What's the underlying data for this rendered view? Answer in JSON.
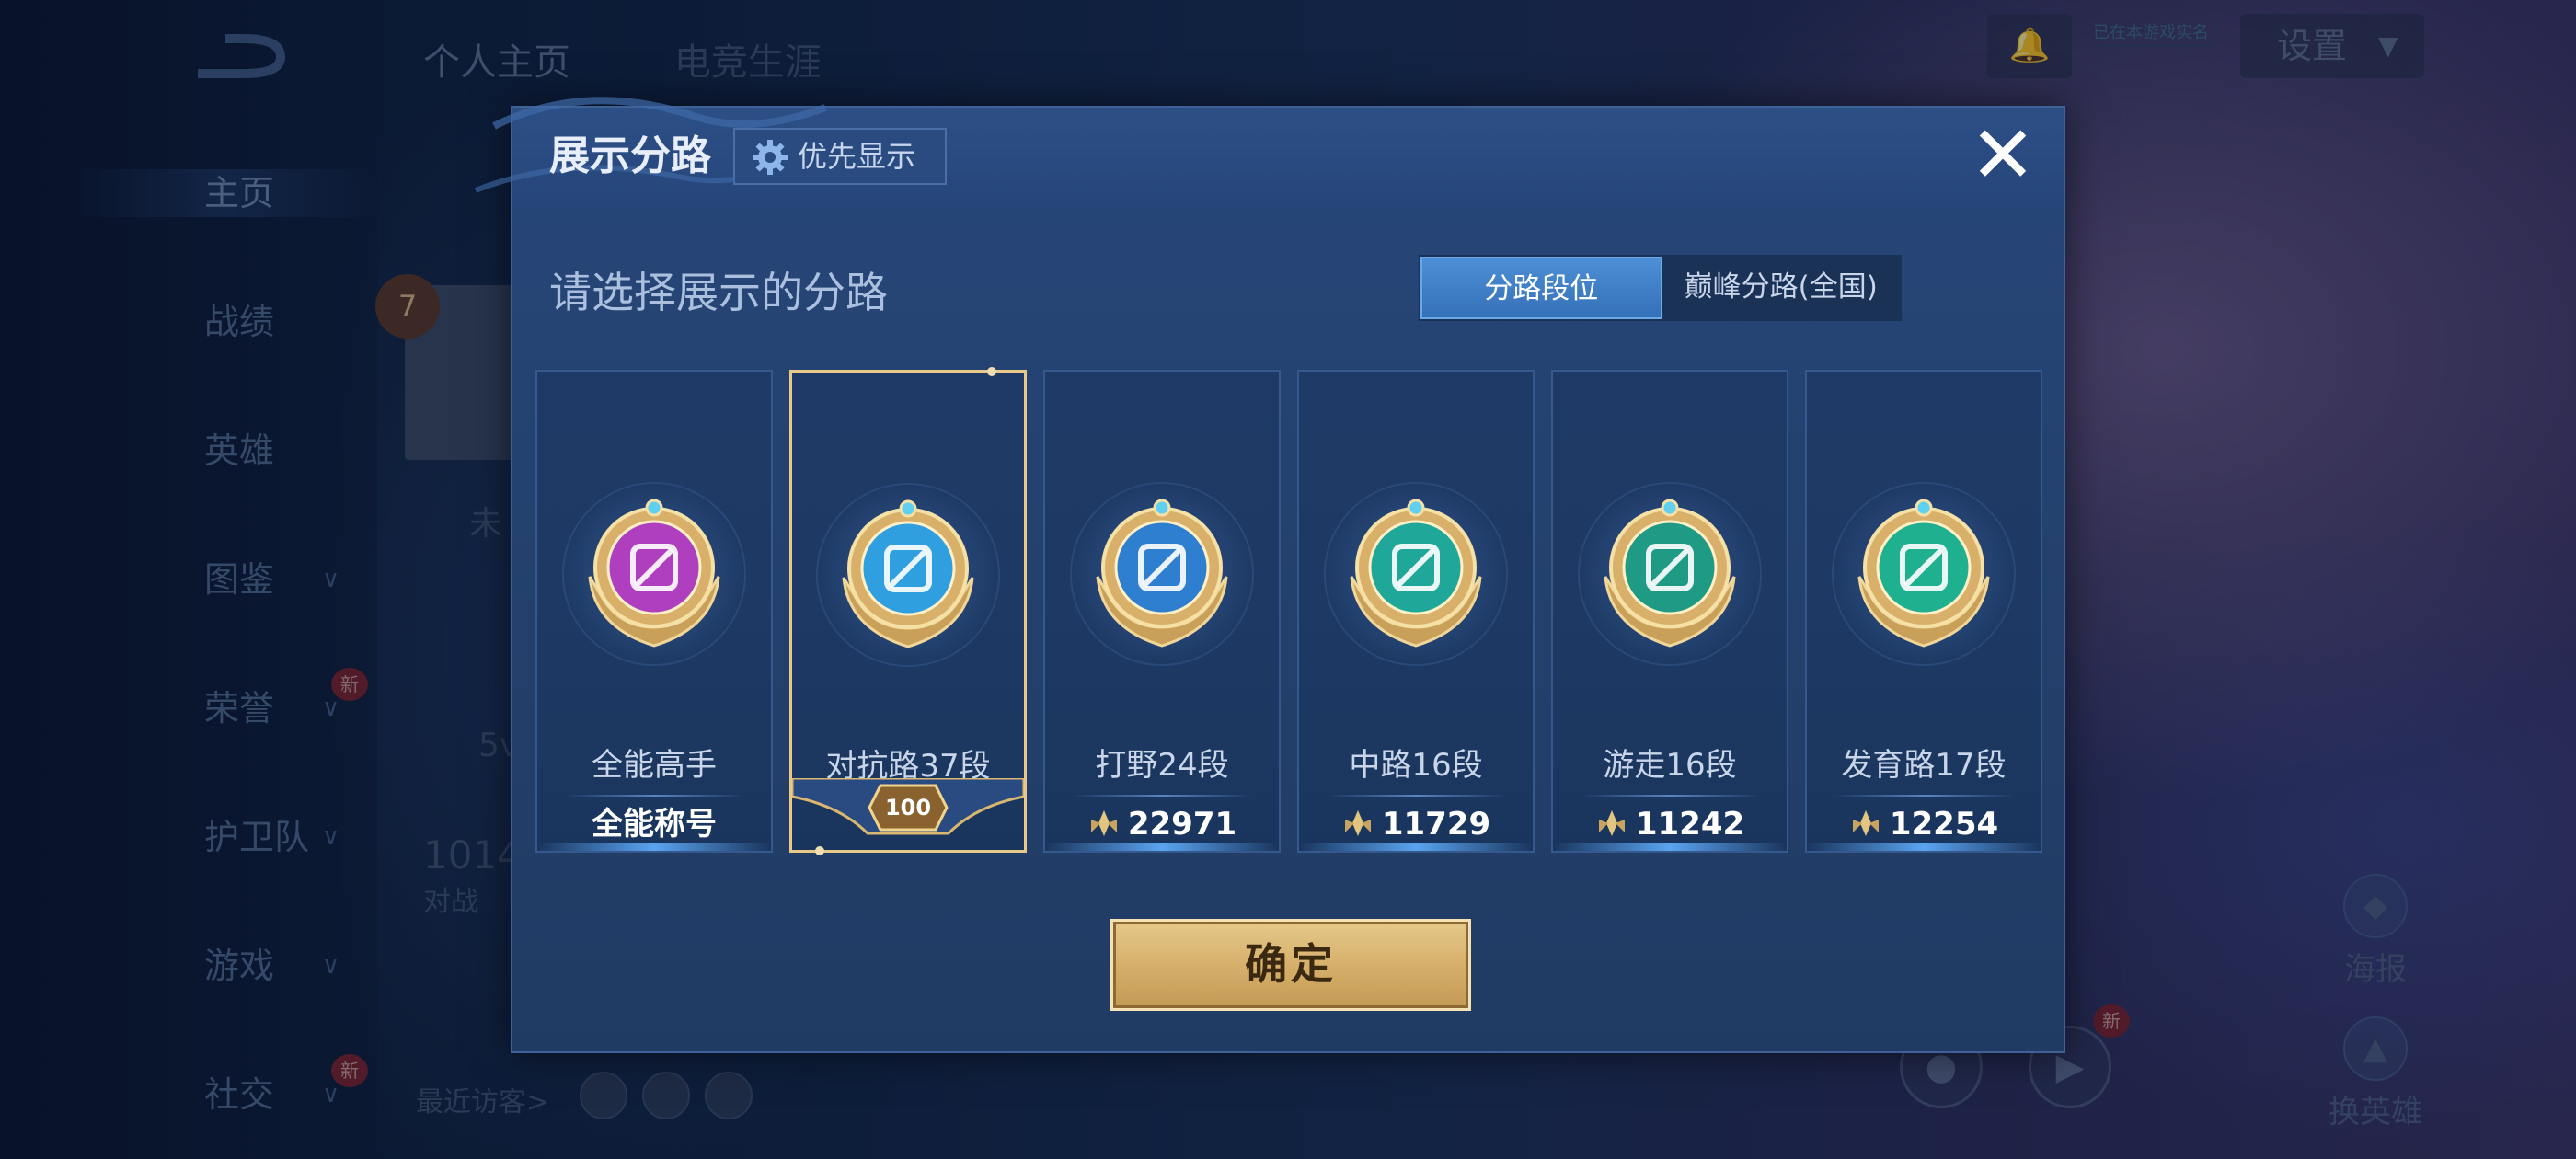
{
  "background": {
    "back_icon": "back-arrow-icon",
    "top_tabs": [
      "个人主页",
      "电竞生涯"
    ],
    "nav": [
      {
        "label": "主页",
        "chevron": false,
        "new": false
      },
      {
        "label": "战绩",
        "chevron": false,
        "new": false
      },
      {
        "label": "英雄",
        "chevron": false,
        "new": false
      },
      {
        "label": "图鉴",
        "chevron": true,
        "new": false
      },
      {
        "label": "荣誉",
        "chevron": true,
        "new": true
      },
      {
        "label": "护卫队",
        "chevron": true,
        "new": false
      },
      {
        "label": "游戏",
        "chevron": true,
        "new": false
      },
      {
        "label": "社交",
        "chevron": true,
        "new": true
      }
    ],
    "new_badge": "新",
    "profile_level": "7",
    "partial_texts": [
      "未",
      "5v",
      "1014",
      "对战"
    ],
    "recent_visitors_label": "最近访客>",
    "settings_label": "设置",
    "tiny_tag": "已在本游戏实名",
    "right_actions": [
      {
        "label": "海报",
        "icon": "poster-icon"
      },
      {
        "label": "换英雄",
        "icon": "swap-hero-icon"
      }
    ],
    "right_new_badge": "新"
  },
  "modal": {
    "title": "展示分路",
    "priority_button": "优先显示",
    "close_icon": "close-icon",
    "section_title": "请选择展示的分路",
    "segments": [
      {
        "label": "分路段位",
        "active": true
      },
      {
        "label": "巅峰分路(全国)",
        "active": false
      }
    ],
    "cards": [
      {
        "name": "全能高手",
        "value": "全能称号",
        "badge": "all-round-emblem-icon",
        "badge_color": "#b03fc0",
        "show_points_icon": false,
        "selected": false
      },
      {
        "name": "对抗路37段",
        "value": "100",
        "badge": "clash-lane-emblem-icon",
        "badge_color": "#2f9fe0",
        "show_points_icon": false,
        "selected": true
      },
      {
        "name": "打野24段",
        "value": "22971",
        "badge": "jungle-emblem-icon",
        "badge_color": "#2f7fd0",
        "show_points_icon": true,
        "selected": false
      },
      {
        "name": "中路16段",
        "value": "11729",
        "badge": "mid-lane-emblem-icon",
        "badge_color": "#1fa89a",
        "show_points_icon": true,
        "selected": false
      },
      {
        "name": "游走16段",
        "value": "11242",
        "badge": "roam-emblem-icon",
        "badge_color": "#1f9a85",
        "show_points_icon": true,
        "selected": false
      },
      {
        "name": "发育路17段",
        "value": "12254",
        "badge": "farm-lane-emblem-icon",
        "badge_color": "#1fb090",
        "show_points_icon": true,
        "selected": false
      }
    ],
    "confirm_label": "确定"
  },
  "colors": {
    "accent_blue": "#3f82cc",
    "gold": "#e9c98a",
    "panel": "#24426f"
  }
}
